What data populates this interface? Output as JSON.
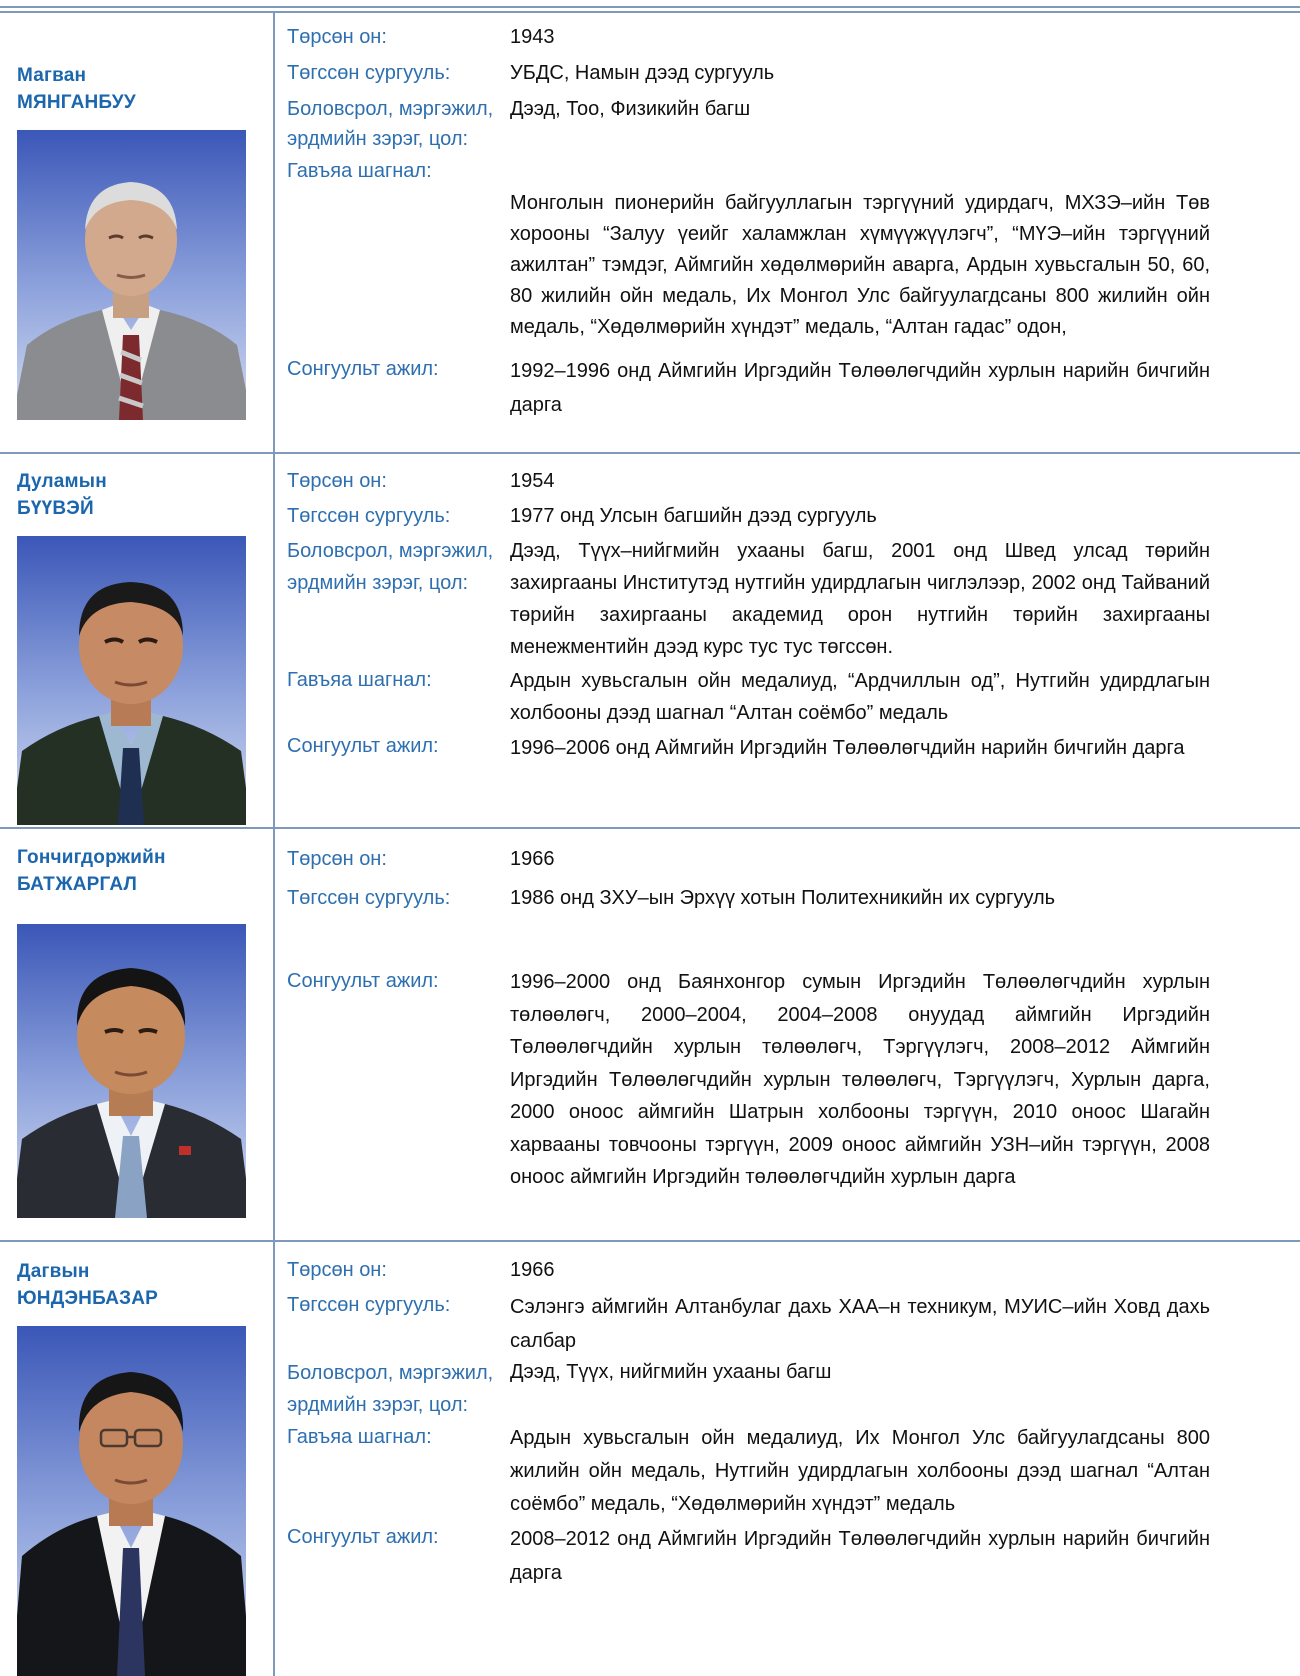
{
  "people": [
    {
      "first_name": "Магван",
      "last_name": "МЯНГАНБУУ",
      "photo": "portrait-photo",
      "rows": [
        {
          "label": "Төрсөн он:",
          "value": "1943"
        },
        {
          "label": "Төгссөн сургууль:",
          "value": "УБДС, Намын дээд сургууль"
        },
        {
          "label": "Боловсрол, мэргэжил, эрдмийн зэрэг, цол:",
          "value": "Дээд, Тоо, Физикийн багш"
        },
        {
          "label": "Гавъяа шагнал:",
          "value": "Монголын пионерийн байгууллагын тэргүүний удирдагч, МХЗЭ–ийн Төв хорооны “Залуу үеийг халамжлан хүмүүжүүлэгч”, “МҮЭ–ийн тэргүүний ажилтан” тэмдэг, Аймгийн хөдөлмөрийн аварга, Ардын хувьсгалын 50, 60, 80 жилийн ойн медаль, Их Монгол Улс байгуулагдсаны 800 жилийн ойн медаль, “Хөдөлмөрийн хүндэт” медаль, “Алтан гадас” одон,"
        },
        {
          "label": "Сонгуульт ажил:",
          "value": "1992–1996 онд Аймгийн Иргэдийн Төлөөлөгчдийн хурлын нарийн бичгийн дарга"
        }
      ]
    },
    {
      "first_name": "Дуламын",
      "last_name": "БҮҮВЭЙ",
      "photo": "portrait-photo",
      "rows": [
        {
          "label": "Төрсөн он:",
          "value": "1954"
        },
        {
          "label": "Төгссөн сургууль:",
          "value": "1977 онд Улсын багшийн дээд сургууль"
        },
        {
          "label": "Боловсрол, мэргэжил, эрдмийн зэрэг, цол:",
          "value": "Дээд, Түүх–нийгмийн ухааны багш, 2001 онд Швед улсад төрийн захиргааны Институтэд нутгийн удирдлагын чиглэлээр, 2002 онд Тайваний төрийн захиргааны академид орон нутгийн төрийн захиргааны менежментийн дээд курс тус тус төгссөн."
        },
        {
          "label": "Гавъяа шагнал:",
          "value": "Ардын хувьсгалын ойн медалиуд, “Ардчиллын од”, Нутгийн удирдлагын холбооны дээд шагнал “Алтан соёмбо” медаль"
        },
        {
          "label": "Сонгуульт ажил:",
          "value": "1996–2006 онд Аймгийн Иргэдийн Төлөөлөгчдийн нарийн бичгийн дарга"
        }
      ]
    },
    {
      "first_name": "Гончигдоржийн",
      "last_name": "БАТЖАРГАЛ",
      "photo": "portrait-photo",
      "rows": [
        {
          "label": "Төрсөн он:",
          "value": "1966"
        },
        {
          "label": "Төгссөн сургууль:",
          "value": "1986 онд ЗХУ–ын Эрхүү хотын Политехникийн их сургууль"
        },
        {
          "label": "Сонгуульт ажил:",
          "value": "1996–2000 онд Баянхонгор сумын Иргэдийн Төлөөлөгчдийн хурлын төлөөлөгч, 2000–2004, 2004–2008 онуудад аймгийн Иргэдийн Төлөөлөгчдийн хурлын төлөөлөгч, Тэргүүлэгч, 2008–2012 Аймгийн Иргэдийн Төлөөлөгчдийн хурлын төлөөлөгч, Тэргүүлэгч, Хурлын дарга, 2000 оноос аймгийн Шатрын холбооны тэргүүн, 2010 оноос Шагайн харвааны товчооны тэргүүн, 2009 оноос аймгийн УЗН–ийн тэргүүн, 2008 оноос аймгийн Иргэдийн төлөөлөгчдийн хурлын дарга"
        }
      ]
    },
    {
      "first_name": "Дагвын",
      "last_name": "ЮНДЭНБАЗАР",
      "photo": "portrait-photo",
      "rows": [
        {
          "label": "Төрсөн он:",
          "value": "1966"
        },
        {
          "label": "Төгссөн сургууль:",
          "value": "Сэлэнгэ аймгийн Алтанбулаг дахь ХАА–н техникум, МУИС–ийн Ховд дахь салбар"
        },
        {
          "label": "Боловсрол, мэргэжил, эрдмийн зэрэг, цол:",
          "value": "Дээд, Түүх, нийгмийн ухааны багш"
        },
        {
          "label": "Гавъяа шагнал:",
          "value": "Ардын хувьсгалын ойн медалиуд, Их Монгол Улс байгуулагдсаны 800 жилийн ойн медаль, Нутгийн удирдлагын холбооны дээд шагнал “Алтан соёмбо” медаль, “Хөдөлмөрийн хүндэт” медаль"
        },
        {
          "label": "Сонгуульт ажил:",
          "value": "2008–2012 онд Аймгийн Иргэдийн Төлөөлөгчдийн хурлын нарийн бичгийн дарга"
        }
      ]
    }
  ]
}
